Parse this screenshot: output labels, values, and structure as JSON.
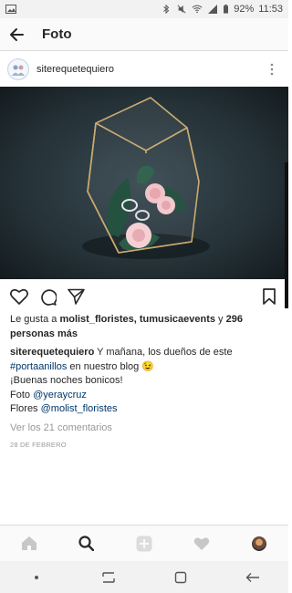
{
  "status_bar": {
    "battery": "92%",
    "time": "11:53",
    "icons": [
      "photo-icon",
      "bluetooth-icon",
      "mute-icon",
      "wifi-icon",
      "signal-icon",
      "battery-icon"
    ]
  },
  "header": {
    "title": "Foto",
    "back_icon": "arrow-left-icon"
  },
  "post": {
    "username": "siterequetequiero",
    "likes_prefix": "Le gusta a ",
    "likes_users": "molist_floristes, tumusicaevents",
    "likes_conj": " y ",
    "likes_count": "296 personas más",
    "caption_user": "siterequetequiero",
    "caption_text": " Y mañana, los dueños de este ",
    "caption_hashtag": "#portaanillos",
    "caption_text2": " en nuestro blog 😉",
    "caption_line2": "¡Buenas noches bonicos!",
    "caption_foto_label": "Foto ",
    "caption_foto_mention": "@yeraycruz",
    "caption_flores_label": "Flores ",
    "caption_flores_mention": "@molist_floristes",
    "comments_link": "Ver los 21 comentarios",
    "date": "28 DE FEBRERO"
  },
  "actions": [
    "heart-icon",
    "comment-icon",
    "share-icon",
    "bookmark-icon"
  ],
  "bottom_nav": [
    "home-icon",
    "search-icon",
    "add-icon",
    "activity-heart-icon",
    "profile-avatar"
  ],
  "system_nav": [
    "dot-icon",
    "recents-icon",
    "home-square-icon",
    "back-icon"
  ],
  "colors": {
    "link": "#003569",
    "muted": "#999999",
    "photo_bg": "#1f2a2f",
    "gold_frame": "#c9a96e",
    "rose": "#f0b8bf"
  }
}
